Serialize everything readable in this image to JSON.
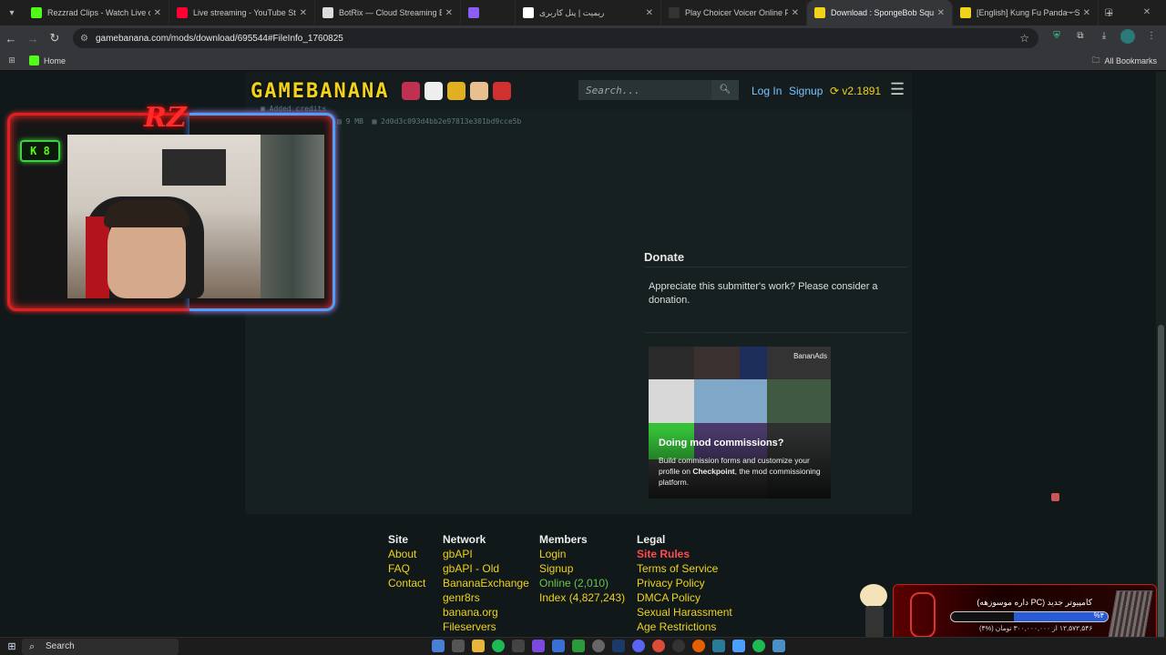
{
  "browser": {
    "tabs": [
      {
        "label": "Rezzrad Clips - Watch Live on K",
        "color": "#53fc18",
        "active": false
      },
      {
        "label": "Live streaming - YouTube Studio",
        "color": "#ff0033",
        "active": false
      },
      {
        "label": "BotRix — Cloud Streaming Bot",
        "color": "#dddddd",
        "active": false
      },
      {
        "label": "",
        "color": "#8b5cf6",
        "active": false
      },
      {
        "label": "ریمیت | پنل کاربری",
        "color": "#ffffff",
        "active": false
      },
      {
        "label": "Play Choicer Voicer Online Free",
        "color": "#333333",
        "active": false
      },
      {
        "label": "Download : SpongeBob Square",
        "color": "#f0d31a",
        "active": true
      },
      {
        "label": "[English] Kung Fu Panda - Shifu",
        "color": "#f0d31a",
        "active": false
      }
    ],
    "url": "gamebanana.com/mods/download/695544#FileInfo_1760825",
    "bookmarks": {
      "home": "Home",
      "all": "All Bookmarks"
    }
  },
  "site": {
    "logo": "GAMEBANANA",
    "search_placeholder": "Search...",
    "login": "Log In",
    "signup": "Signup",
    "version": "v2.1891"
  },
  "file": {
    "credits_label": "Added credits",
    "size": "9 MB",
    "hash": "2d0d3c093d4bb2e97813e301bd9cce5b"
  },
  "donate": {
    "heading": "Donate",
    "text": "Appreciate this submitter's work? Please consider a donation."
  },
  "ad": {
    "badge": "BananAds",
    "heading": "Doing mod commissions?",
    "text_pre": "Build commission forms and customize your profile on ",
    "text_bold": "Checkpoint",
    "text_post": ", the mod commissioning platform."
  },
  "footer": {
    "site": {
      "heading": "Site",
      "links": [
        "About",
        "FAQ",
        "Contact"
      ]
    },
    "network": {
      "heading": "Network",
      "links": [
        "gbAPI",
        "gbAPI - Old",
        "BananaExchange",
        "genr8rs",
        "banana.org",
        "Fileservers"
      ]
    },
    "members": {
      "heading": "Members",
      "links": [
        "Login",
        "Signup",
        "Online (2,010)",
        "Index (4,827,243)"
      ]
    },
    "legal": {
      "heading": "Legal",
      "links": [
        "Site Rules",
        "Terms of Service",
        "Privacy Policy",
        "DMCA Policy",
        "Sexual Harassment",
        "Age Restrictions"
      ]
    }
  },
  "stream": {
    "logo_text": "RZ",
    "viewer_count": "8",
    "goal_title": "کامپیوتر جدید (PC داره موسوزهه)",
    "goal_percent": "%۴",
    "goal_progress": 0.04,
    "goal_sub": "۱۲,۵۷۲,۵۴۶ از ۳۰۰,۰۰۰,۰۰۰ تومان (%۴)"
  },
  "taskbar": {
    "search": "Search"
  }
}
